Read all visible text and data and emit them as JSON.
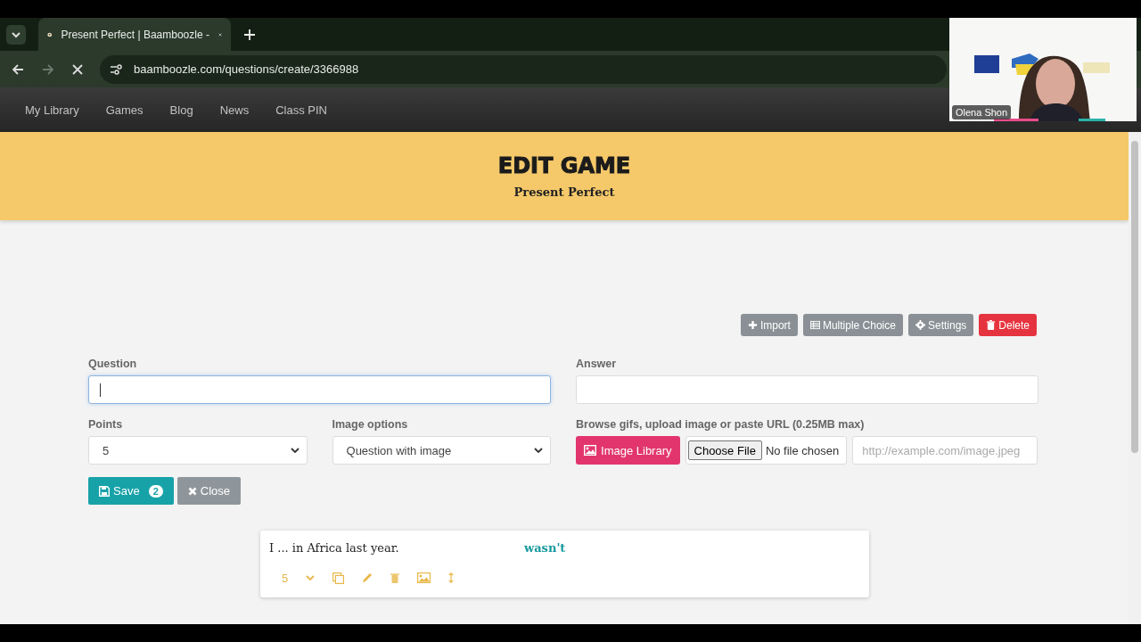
{
  "browser": {
    "tab_title": "Present Perfect | Baamboozle -",
    "url": "baamboozle.com/questions/create/3366988"
  },
  "nav": {
    "items": [
      "My Library",
      "Games",
      "Blog",
      "News",
      "Class PIN"
    ]
  },
  "header": {
    "title": "EDIT GAME",
    "subtitle": "Present Perfect"
  },
  "toolbar": [
    {
      "label": "Import",
      "kind": "import"
    },
    {
      "label": "Multiple Choice",
      "kind": "mode"
    },
    {
      "label": "Settings",
      "kind": "settings"
    },
    {
      "label": "Delete",
      "kind": "delete"
    }
  ],
  "form": {
    "question": {
      "label": "Question",
      "focused": true
    },
    "answer": {
      "label": "Answer",
      "focused": false
    },
    "points": {
      "label": "Points",
      "value": "5"
    },
    "image_options": {
      "label": "Image options",
      "value": "Question with image"
    },
    "image": {
      "label": "Browse gifs, upload image or paste URL (0.25MB max)",
      "library_button": "Image Library",
      "file_button": "Choose File",
      "file_status": "No file chosen",
      "url_placeholder": "http://example.com/image.jpeg"
    },
    "save": {
      "label": "Save",
      "badge": "2"
    },
    "close": {
      "label": "Close"
    }
  },
  "questions": [
    {
      "question": "I ... in Africa last year.",
      "answer": "wasn't",
      "points": "5"
    }
  ],
  "video": {
    "participant": "Olena Shon"
  }
}
